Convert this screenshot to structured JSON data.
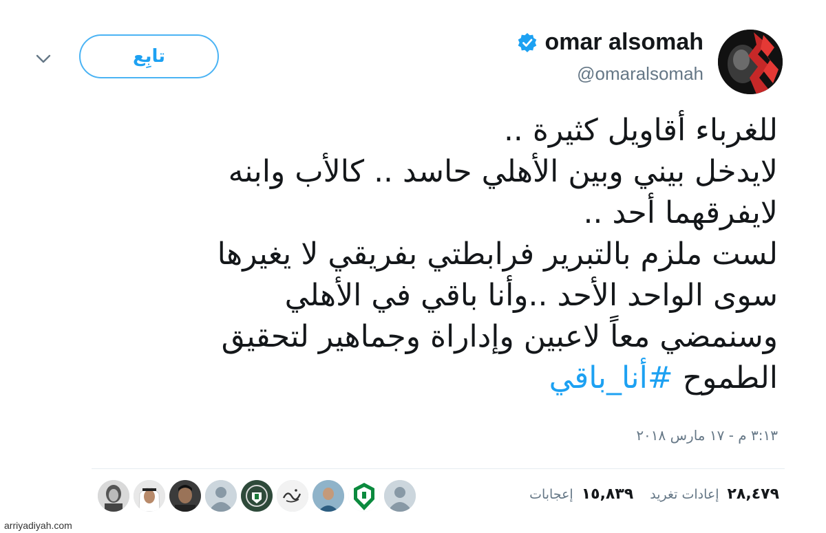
{
  "header": {
    "follow_label": "تابِع",
    "display_name": "omar alsomah",
    "handle": "@omaralsomah"
  },
  "tweet": {
    "lines": [
      "للغرباء أقاويل كثيرة ..",
      "لايدخل بيني وبين الأهلي حاسد .. كالأب وابنه",
      "لايفرقهما أحد ..",
      "لست ملزم بالتبرير فرابطتي بفريقي لا يغيرها",
      "سوى الواحد الأحد ..وأنا باقي في الأهلي",
      "وسنمضي معاً لاعبين وإداراة وجماهير لتحقيق"
    ],
    "last_line_text": "الطموح",
    "hashtag": "#أنا_باقي",
    "timestamp": "٣:١٣ م - ١٧ مارس ٢٠١٨"
  },
  "stats": {
    "retweets_value": "٢٨,٤٧٩",
    "retweets_label": "إعادات تغريد",
    "likes_value": "١٥,٨٣٩",
    "likes_label": "إعجابات"
  },
  "likers": [
    {
      "icon": "avatar-sketch"
    },
    {
      "icon": "avatar-ghutra"
    },
    {
      "icon": "avatar-man"
    },
    {
      "icon": "avatar-default"
    },
    {
      "icon": "avatar-crest"
    },
    {
      "icon": "avatar-calligraphy"
    },
    {
      "icon": "avatar-photo"
    },
    {
      "icon": "avatar-alahli-logo"
    },
    {
      "icon": "avatar-default"
    }
  ],
  "watermark": "arriyadiyah.com",
  "colors": {
    "accent": "#1da1f2",
    "text": "#14171a",
    "secondary": "#657786",
    "divider": "#e6ecf0"
  }
}
